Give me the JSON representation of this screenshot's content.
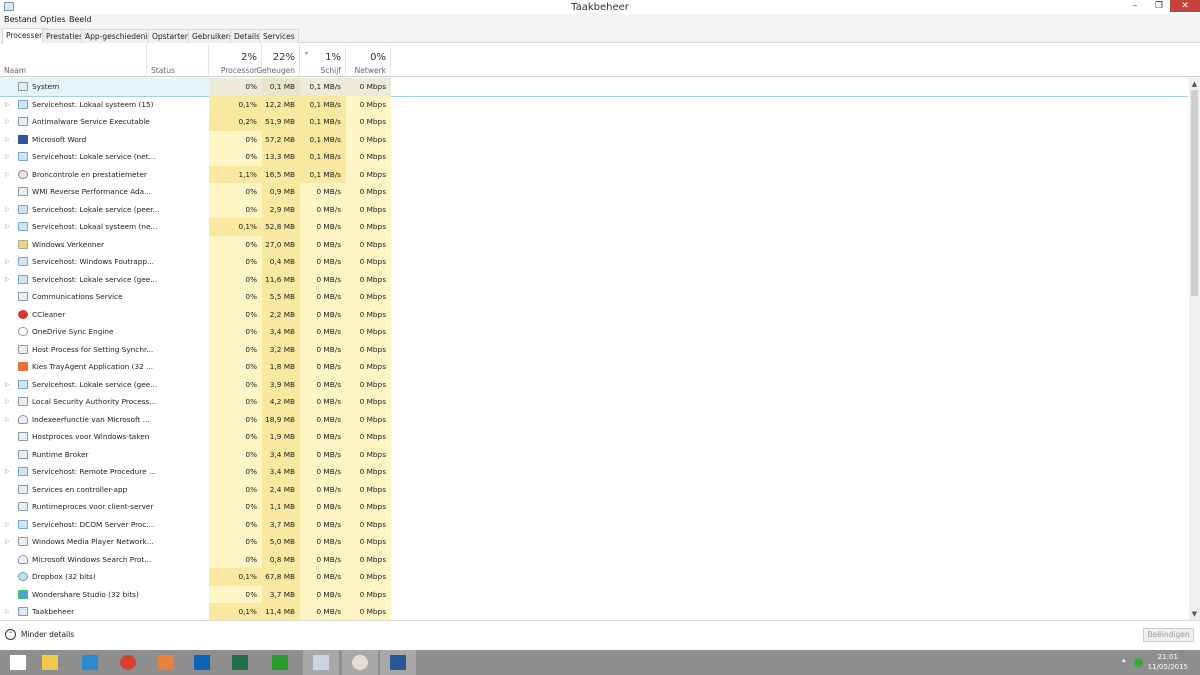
{
  "window": {
    "title": "Taakbeheer",
    "minimize": "–",
    "restore": "❐",
    "close": "✕"
  },
  "menu": [
    "Bestand",
    "Opties",
    "Beeld"
  ],
  "tabs": [
    "Processen",
    "Prestaties",
    "App-geschiedenis",
    "Opstarten",
    "Gebruikers",
    "Details",
    "Services"
  ],
  "columns": {
    "name": "Naam",
    "status": "Status",
    "cpu": {
      "pct": "2%",
      "label": "Processor"
    },
    "mem": {
      "pct": "22%",
      "label": "Geheugen"
    },
    "disk": {
      "pct": "1%",
      "label": "Schijf"
    },
    "net": {
      "pct": "0%",
      "label": "Netwerk"
    }
  },
  "processes": [
    {
      "name": "System",
      "icon": "win",
      "exp": false,
      "cpu": "0%",
      "mem": "0,1 MB",
      "disk": "0,1 MB/s",
      "net": "0 Mbps"
    },
    {
      "name": "Servicehost: Lokaal systeem (15)",
      "icon": "svc",
      "exp": true,
      "cpu": "0,1%",
      "mem": "12,2 MB",
      "disk": "0,1 MB/s",
      "net": "0 Mbps"
    },
    {
      "name": "Antimalware Service Executable",
      "icon": "win",
      "exp": true,
      "cpu": "0,2%",
      "mem": "51,9 MB",
      "disk": "0,1 MB/s",
      "net": "0 Mbps"
    },
    {
      "name": "Microsoft Word",
      "icon": "word",
      "exp": true,
      "cpu": "0%",
      "mem": "57,2 MB",
      "disk": "0,1 MB/s",
      "net": "0 Mbps"
    },
    {
      "name": "Servicehost: Lokale service (net...",
      "icon": "svc",
      "exp": true,
      "cpu": "0%",
      "mem": "13,3 MB",
      "disk": "0,1 MB/s",
      "net": "0 Mbps"
    },
    {
      "name": "Broncontrole en prestatiemeter",
      "icon": "gauge",
      "exp": true,
      "cpu": "1,1%",
      "mem": "16,5 MB",
      "disk": "0,1 MB/s",
      "net": "0 Mbps"
    },
    {
      "name": "WMI Reverse Performance Ada...",
      "icon": "win",
      "exp": false,
      "cpu": "0%",
      "mem": "0,9 MB",
      "disk": "0 MB/s",
      "net": "0 Mbps"
    },
    {
      "name": "Servicehost: Lokale service (peer...",
      "icon": "svc",
      "exp": true,
      "cpu": "0%",
      "mem": "2,9 MB",
      "disk": "0 MB/s",
      "net": "0 Mbps"
    },
    {
      "name": "Servicehost: Lokaal systeem (ne...",
      "icon": "svc",
      "exp": true,
      "cpu": "0,1%",
      "mem": "52,8 MB",
      "disk": "0 MB/s",
      "net": "0 Mbps"
    },
    {
      "name": "Windows Verkenner",
      "icon": "explorer",
      "exp": false,
      "cpu": "0%",
      "mem": "27,0 MB",
      "disk": "0 MB/s",
      "net": "0 Mbps"
    },
    {
      "name": "Servicehost: Windows Foutrapp...",
      "icon": "svc",
      "exp": true,
      "cpu": "0%",
      "mem": "0,4 MB",
      "disk": "0 MB/s",
      "net": "0 Mbps"
    },
    {
      "name": "Servicehost: Lokale service (gee...",
      "icon": "svc",
      "exp": true,
      "cpu": "0%",
      "mem": "11,6 MB",
      "disk": "0 MB/s",
      "net": "0 Mbps"
    },
    {
      "name": "Communications Service",
      "icon": "win",
      "exp": false,
      "cpu": "0%",
      "mem": "5,5 MB",
      "disk": "0 MB/s",
      "net": "0 Mbps"
    },
    {
      "name": "CCleaner",
      "icon": "ccleaner",
      "exp": false,
      "cpu": "0%",
      "mem": "2,2 MB",
      "disk": "0 MB/s",
      "net": "0 Mbps"
    },
    {
      "name": "OneDrive Sync Engine",
      "icon": "cloud",
      "exp": false,
      "cpu": "0%",
      "mem": "3,4 MB",
      "disk": "0 MB/s",
      "net": "0 Mbps"
    },
    {
      "name": "Host Process for Setting Synchr...",
      "icon": "win",
      "exp": false,
      "cpu": "0%",
      "mem": "3,2 MB",
      "disk": "0 MB/s",
      "net": "0 Mbps"
    },
    {
      "name": "Kies TrayAgent Application (32 ...",
      "icon": "kies",
      "exp": false,
      "cpu": "0%",
      "mem": "1,8 MB",
      "disk": "0 MB/s",
      "net": "0 Mbps"
    },
    {
      "name": "Servicehost: Lokale service (gee...",
      "icon": "svc",
      "exp": true,
      "cpu": "0%",
      "mem": "3,9 MB",
      "disk": "0 MB/s",
      "net": "0 Mbps"
    },
    {
      "name": "Local Security Authority Process...",
      "icon": "win",
      "exp": true,
      "cpu": "0%",
      "mem": "4,2 MB",
      "disk": "0 MB/s",
      "net": "0 Mbps"
    },
    {
      "name": "Indexeerfunctie van Microsoft ...",
      "icon": "search",
      "exp": true,
      "cpu": "0%",
      "mem": "18,9 MB",
      "disk": "0 MB/s",
      "net": "0 Mbps"
    },
    {
      "name": "Hostproces voor Windows-taken",
      "icon": "win",
      "exp": false,
      "cpu": "0%",
      "mem": "1,9 MB",
      "disk": "0 MB/s",
      "net": "0 Mbps"
    },
    {
      "name": "Runtime Broker",
      "icon": "win",
      "exp": false,
      "cpu": "0%",
      "mem": "3,4 MB",
      "disk": "0 MB/s",
      "net": "0 Mbps"
    },
    {
      "name": "Servicehost: Remote Procedure ...",
      "icon": "svc",
      "exp": true,
      "cpu": "0%",
      "mem": "3,4 MB",
      "disk": "0 MB/s",
      "net": "0 Mbps"
    },
    {
      "name": "Services en controller-app",
      "icon": "win",
      "exp": false,
      "cpu": "0%",
      "mem": "2,4 MB",
      "disk": "0 MB/s",
      "net": "0 Mbps"
    },
    {
      "name": "Runtimeproces voor client-server",
      "icon": "win",
      "exp": false,
      "cpu": "0%",
      "mem": "1,1 MB",
      "disk": "0 MB/s",
      "net": "0 Mbps"
    },
    {
      "name": "Servicehost: DCOM Server Proc...",
      "icon": "svc",
      "exp": true,
      "cpu": "0%",
      "mem": "3,7 MB",
      "disk": "0 MB/s",
      "net": "0 Mbps"
    },
    {
      "name": "Windows Media Player Network...",
      "icon": "win",
      "exp": true,
      "cpu": "0%",
      "mem": "5,0 MB",
      "disk": "0 MB/s",
      "net": "0 Mbps"
    },
    {
      "name": "Microsoft Windows Search Prot...",
      "icon": "search",
      "exp": false,
      "cpu": "0%",
      "mem": "0,8 MB",
      "disk": "0 MB/s",
      "net": "0 Mbps"
    },
    {
      "name": "Dropbox (32 bits)",
      "icon": "dropbox",
      "exp": false,
      "cpu": "0,1%",
      "mem": "67,8 MB",
      "disk": "0 MB/s",
      "net": "0 Mbps"
    },
    {
      "name": "Wondershare Studio (32 bits)",
      "icon": "wonder",
      "exp": false,
      "cpu": "0%",
      "mem": "3,7 MB",
      "disk": "0 MB/s",
      "net": "0 Mbps"
    },
    {
      "name": "Taakbeheer",
      "icon": "taskmgr",
      "exp": true,
      "cpu": "0,1%",
      "mem": "11,4 MB",
      "disk": "0 MB/s",
      "net": "0 Mbps"
    }
  ],
  "footer": {
    "less_details": "Minder details",
    "end_task": "Beëindigen"
  },
  "taskbar": {
    "apps": [
      {
        "name": "start",
        "color": "#ffffff"
      },
      {
        "name": "file-explorer",
        "color": "#f2c94c"
      },
      {
        "name": "internet-explorer",
        "color": "#2a8ad4"
      },
      {
        "name": "chrome",
        "color": "#d9412f"
      },
      {
        "name": "media-player",
        "color": "#e8823a"
      },
      {
        "name": "outlook",
        "color": "#0a64b8"
      },
      {
        "name": "excel",
        "color": "#1e7145"
      },
      {
        "name": "store",
        "color": "#2a9a2a"
      },
      {
        "name": "task-manager",
        "color": "#c9d6e2",
        "active": true
      },
      {
        "name": "resource-monitor",
        "color": "#e9dada",
        "active": true
      },
      {
        "name": "word",
        "color": "#2b5797",
        "active": true
      }
    ],
    "time": "21:01",
    "date": "11/05/2015"
  },
  "colors": {
    "heat_low": "#fff4c4",
    "heat_mid": "#fcefb2",
    "heat_high": "#f9e8a0"
  }
}
